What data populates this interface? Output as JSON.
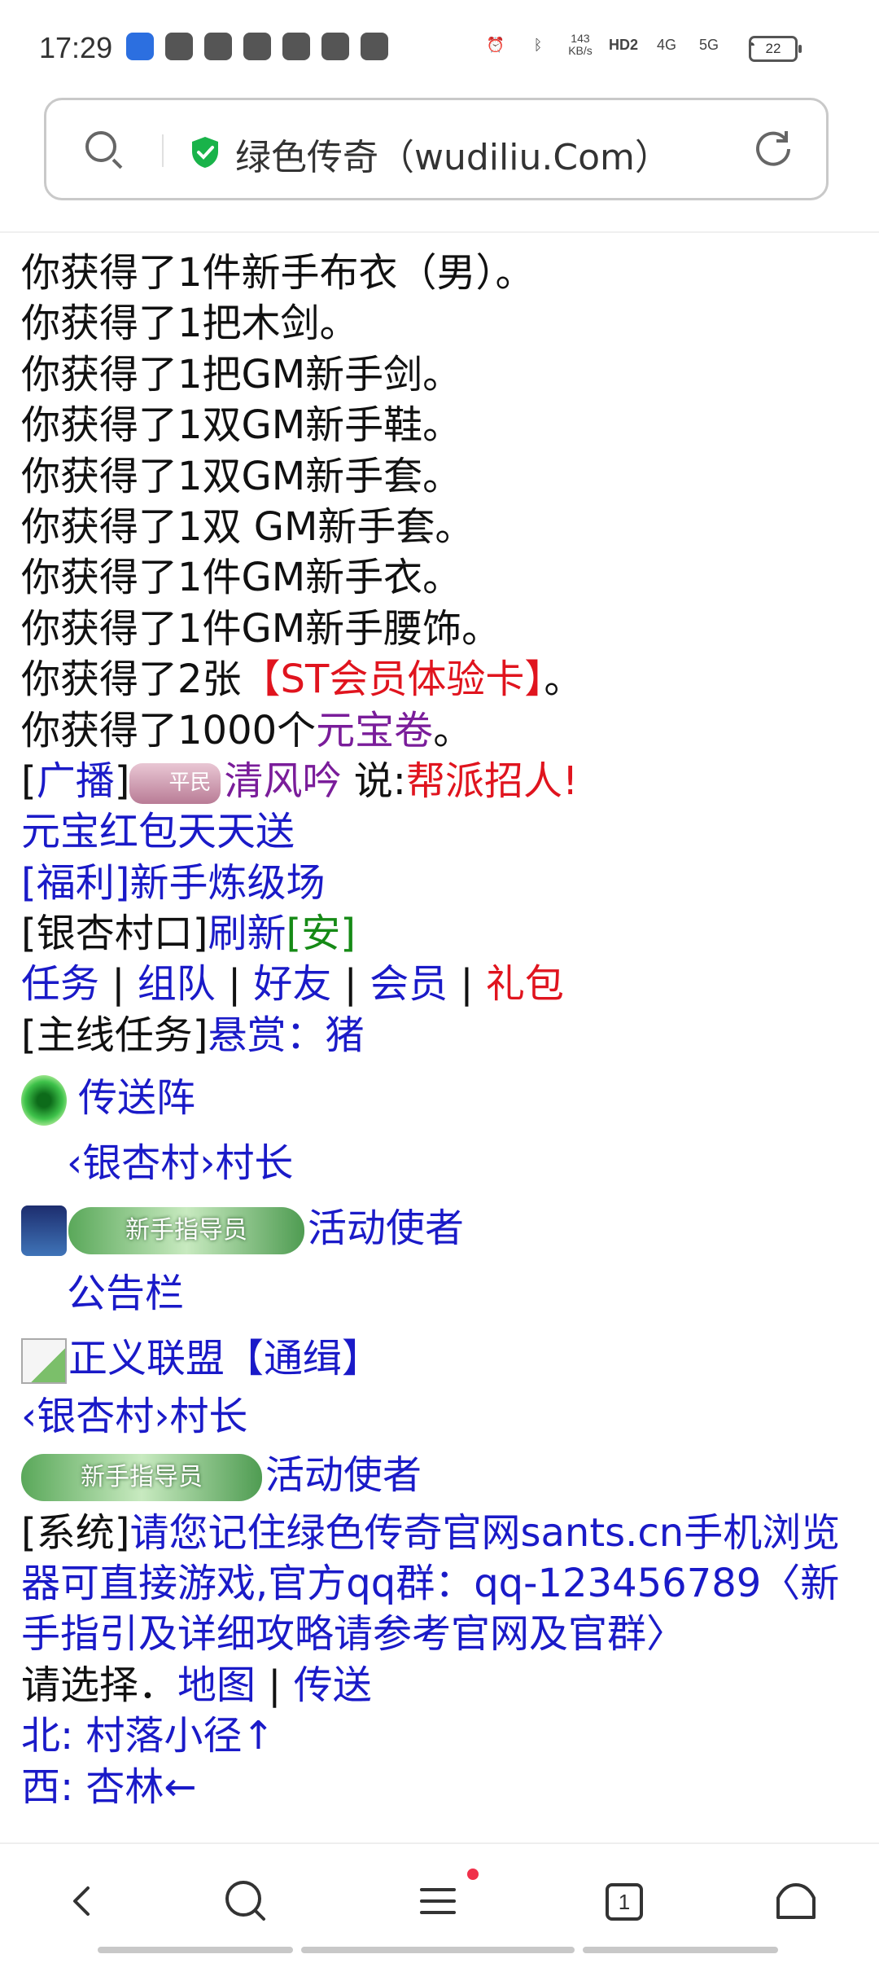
{
  "status_bar": {
    "time": "17:29",
    "network_speed": "143\nKB/s",
    "hd_label": "HD2",
    "signal_4g": "4G",
    "signal_5g": "5G",
    "battery": "22"
  },
  "address_bar": {
    "site_title": "绿色传奇（wudiliu.Com）",
    "secure_icon": "shield-check-icon",
    "reload_icon": "reload-icon",
    "search_icon": "search-icon"
  },
  "messages": [
    "你获得了1件新手布衣（男）。",
    "你获得了1把木剑。",
    "你获得了1把GM新手剑。",
    "你获得了1双GM新手鞋。",
    "你获得了1双GM新手套。",
    "你获得了1双 GM新手套。",
    "你获得了1件GM新手衣。",
    "你获得了1件GM新手腰饰。"
  ],
  "vip_line": {
    "prefix": "你获得了2张",
    "item": "【ST会员体验卡】",
    "suffix": "。"
  },
  "ingot_line": {
    "prefix": "你获得了1000个",
    "item": "元宝卷",
    "suffix": "。"
  },
  "broadcast": {
    "bracket_open": "[",
    "label": "广播",
    "bracket_close": "]",
    "badge_text": "平民",
    "user": "清风吟",
    "say": " 说:",
    "message": "帮派招人!"
  },
  "links": {
    "ingot_gift": "元宝红包天天送",
    "welfare": "[福利]新手炼级场"
  },
  "location": {
    "place": "[银杏村口]",
    "refresh": "刷新",
    "safe": "[安]"
  },
  "menu": {
    "items": [
      "任务",
      "组队",
      "好友",
      "会员"
    ],
    "gift": "礼包",
    "sep": " | "
  },
  "quest": {
    "label": "[主线任务]",
    "link": "悬赏：猪"
  },
  "npcs": {
    "portal": "传送阵",
    "village_chief_1": "‹银杏村›村长",
    "guide_banner": "新手指导员",
    "envoy_1": "活动使者",
    "notice_board": "公告栏",
    "justice_league": "正义联盟【通缉】",
    "village_chief_2": "‹银杏村›村长",
    "envoy_2": "活动使者"
  },
  "system": {
    "label": "[系统]",
    "text": "请您记住绿色传奇官网sants.cn手机浏览器可直接游戏,官方qq群：qq-123456789〈新手指引及详细攻略请参考官网及官群〉"
  },
  "choose": {
    "label": "请选择．",
    "map": "地图",
    "sep": " | ",
    "teleport": "传送"
  },
  "directions": {
    "north": "北: 村落小径↑",
    "west": "西: 杏林←"
  },
  "bottom_nav": {
    "back_icon": "back-icon",
    "search_icon": "search-icon",
    "menu_icon": "menu-icon",
    "tabs_count": "1",
    "home_icon": "home-icon"
  }
}
